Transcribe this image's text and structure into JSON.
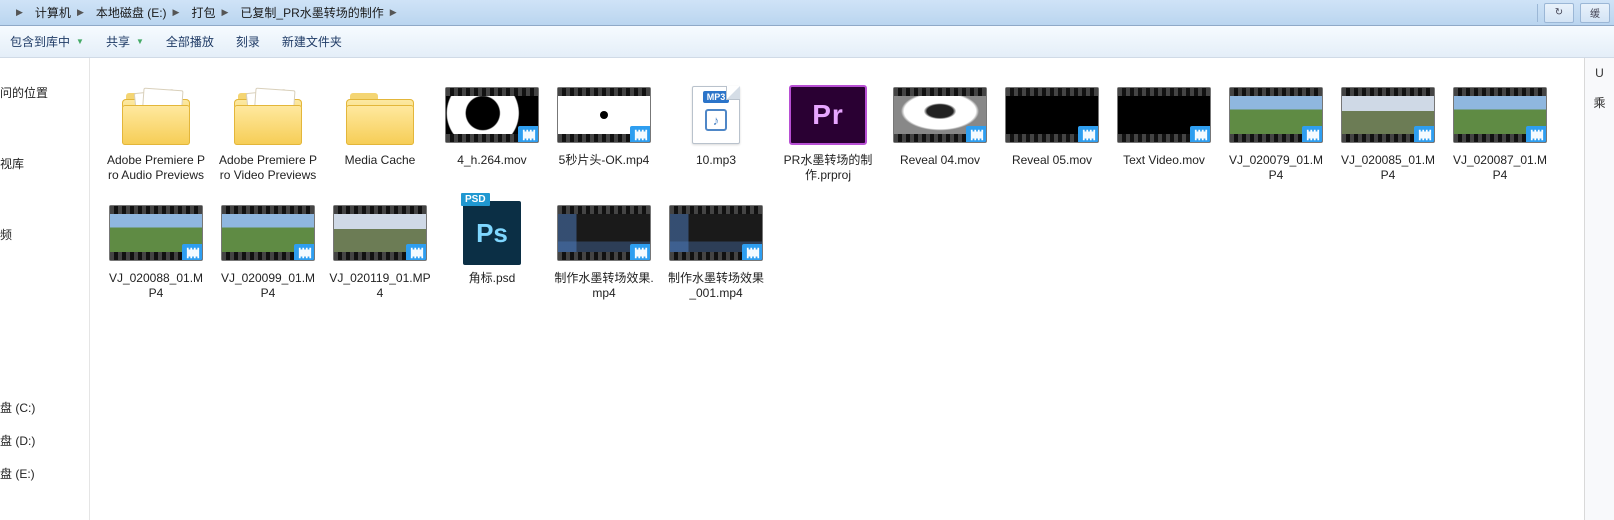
{
  "breadcrumb": {
    "items": [
      "计算机",
      "本地磁盘 (E:)",
      "打包",
      "已复制_PR水墨转场的制作"
    ]
  },
  "addrbar_right": {
    "btn1": "↻",
    "btn2": "缓"
  },
  "toolbar": {
    "organize": "包含到库中",
    "share": "共享",
    "playall": "全部播放",
    "burn": "刻录",
    "newfolder": "新建文件夹"
  },
  "sidebar": {
    "items": [
      "问的位置",
      "视库",
      "频",
      "盘 (C:)",
      "盘 (D:)",
      "盘 (E:)"
    ]
  },
  "rightcol": {
    "items": [
      "U",
      "乘"
    ]
  },
  "files": [
    {
      "kind": "folder-papers",
      "name": "Adobe Premiere Pro Audio Previews"
    },
    {
      "kind": "folder-papers",
      "name": "Adobe Premiere Pro Video Previews"
    },
    {
      "kind": "folder",
      "name": "Media Cache"
    },
    {
      "kind": "video",
      "variant": "ink",
      "name": "4_h.264.mov"
    },
    {
      "kind": "video",
      "variant": "dot",
      "name": "5秒片头-OK.mp4"
    },
    {
      "kind": "mp3",
      "name": "10.mp3",
      "tag": "MP3"
    },
    {
      "kind": "prproj",
      "name": "PR水墨转场的制作.prproj",
      "logo": "Pr"
    },
    {
      "kind": "video",
      "variant": "smoke",
      "name": "Reveal 04.mov"
    },
    {
      "kind": "video",
      "variant": "",
      "name": "Reveal 05.mov"
    },
    {
      "kind": "video",
      "variant": "",
      "name": "Text Video.mov"
    },
    {
      "kind": "video",
      "variant": "nature",
      "name": "VJ_020079_01.MP4"
    },
    {
      "kind": "video",
      "variant": "nature2",
      "name": "VJ_020085_01.MP4"
    },
    {
      "kind": "video",
      "variant": "nature",
      "name": "VJ_020087_01.MP4"
    },
    {
      "kind": "video",
      "variant": "nature",
      "name": "VJ_020088_01.MP4"
    },
    {
      "kind": "video",
      "variant": "nature",
      "name": "VJ_020099_01.MP4"
    },
    {
      "kind": "video",
      "variant": "nature2",
      "name": "VJ_020119_01.MP4"
    },
    {
      "kind": "psd",
      "name": "角标.psd",
      "logo": "Ps",
      "flag": "PSD"
    },
    {
      "kind": "video",
      "variant": "app",
      "name": "制作水墨转场效果.mp4"
    },
    {
      "kind": "video",
      "variant": "app",
      "name": "制作水墨转场效果_001.mp4"
    }
  ]
}
